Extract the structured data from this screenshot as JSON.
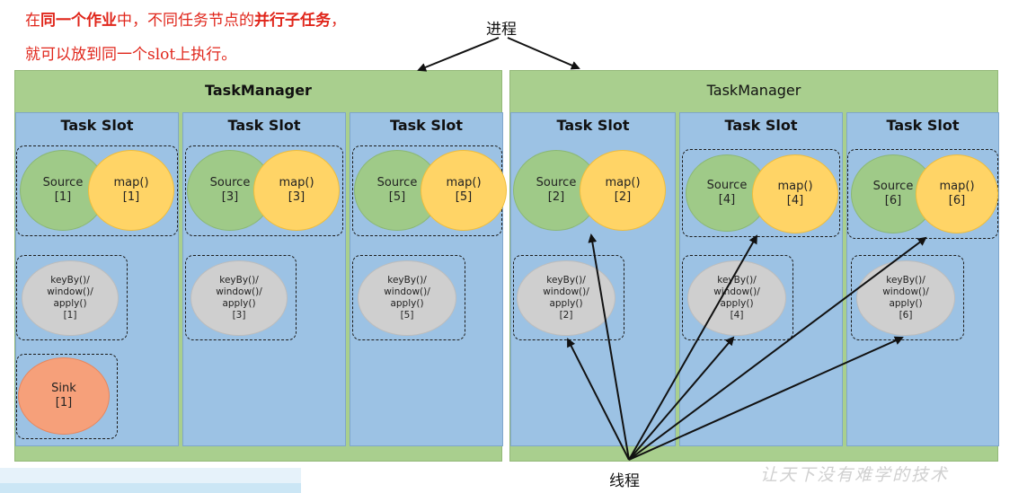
{
  "notes": {
    "line1": {
      "p1": "在",
      "p2": "同一个作业",
      "p3": "中，不同任务节点的",
      "p4": "并行子任务",
      "p5": "，"
    },
    "line2": "就可以放到同一个slot上执行。"
  },
  "labels": {
    "process": "进程",
    "thread": "线程",
    "watermark": "让天下没有难学的技术"
  },
  "task_managers": [
    {
      "title": "TaskManager",
      "slots": [
        {
          "title": "Task Slot",
          "source": [
            "Source",
            "[1]"
          ],
          "map": [
            "map()",
            "[1]"
          ],
          "keyby": [
            "keyBy()/",
            "window()/",
            "apply()",
            "[1]"
          ],
          "sink": [
            "Sink",
            "[1]"
          ]
        },
        {
          "title": "Task Slot",
          "source": [
            "Source",
            "[3]"
          ],
          "map": [
            "map()",
            "[3]"
          ],
          "keyby": [
            "keyBy()/",
            "window()/",
            "apply()",
            "[3]"
          ]
        },
        {
          "title": "Task Slot",
          "source": [
            "Source",
            "[5]"
          ],
          "map": [
            "map()",
            "[5]"
          ],
          "keyby": [
            "keyBy()/",
            "window()/",
            "apply()",
            "[5]"
          ]
        }
      ]
    },
    {
      "title": "TaskManager",
      "slots": [
        {
          "title": "Task Slot",
          "source": [
            "Source",
            "[2]"
          ],
          "map": [
            "map()",
            "[2]"
          ],
          "keyby": [
            "keyBy()/",
            "window()/",
            "apply()",
            "[2]"
          ]
        },
        {
          "title": "Task Slot",
          "source": [
            "Source",
            "[4]"
          ],
          "map": [
            "map()",
            "[4]"
          ],
          "keyby": [
            "keyBy()/",
            "window()/",
            "apply()",
            "[4]"
          ]
        },
        {
          "title": "Task Slot",
          "source": [
            "Source",
            "[6]"
          ],
          "map": [
            "map()",
            "[6]"
          ],
          "keyby": [
            "keyBy()/",
            "window()/",
            "apply()",
            "[6]"
          ]
        }
      ]
    }
  ],
  "colors": {
    "task_manager": "#a9cf8e",
    "task_slot": "#9cc2e4",
    "source": "#9fca88",
    "map": "#ffd466",
    "keyby": "#cfcfcf",
    "sink": "#f6a07a",
    "note_text": "#e0261b"
  }
}
